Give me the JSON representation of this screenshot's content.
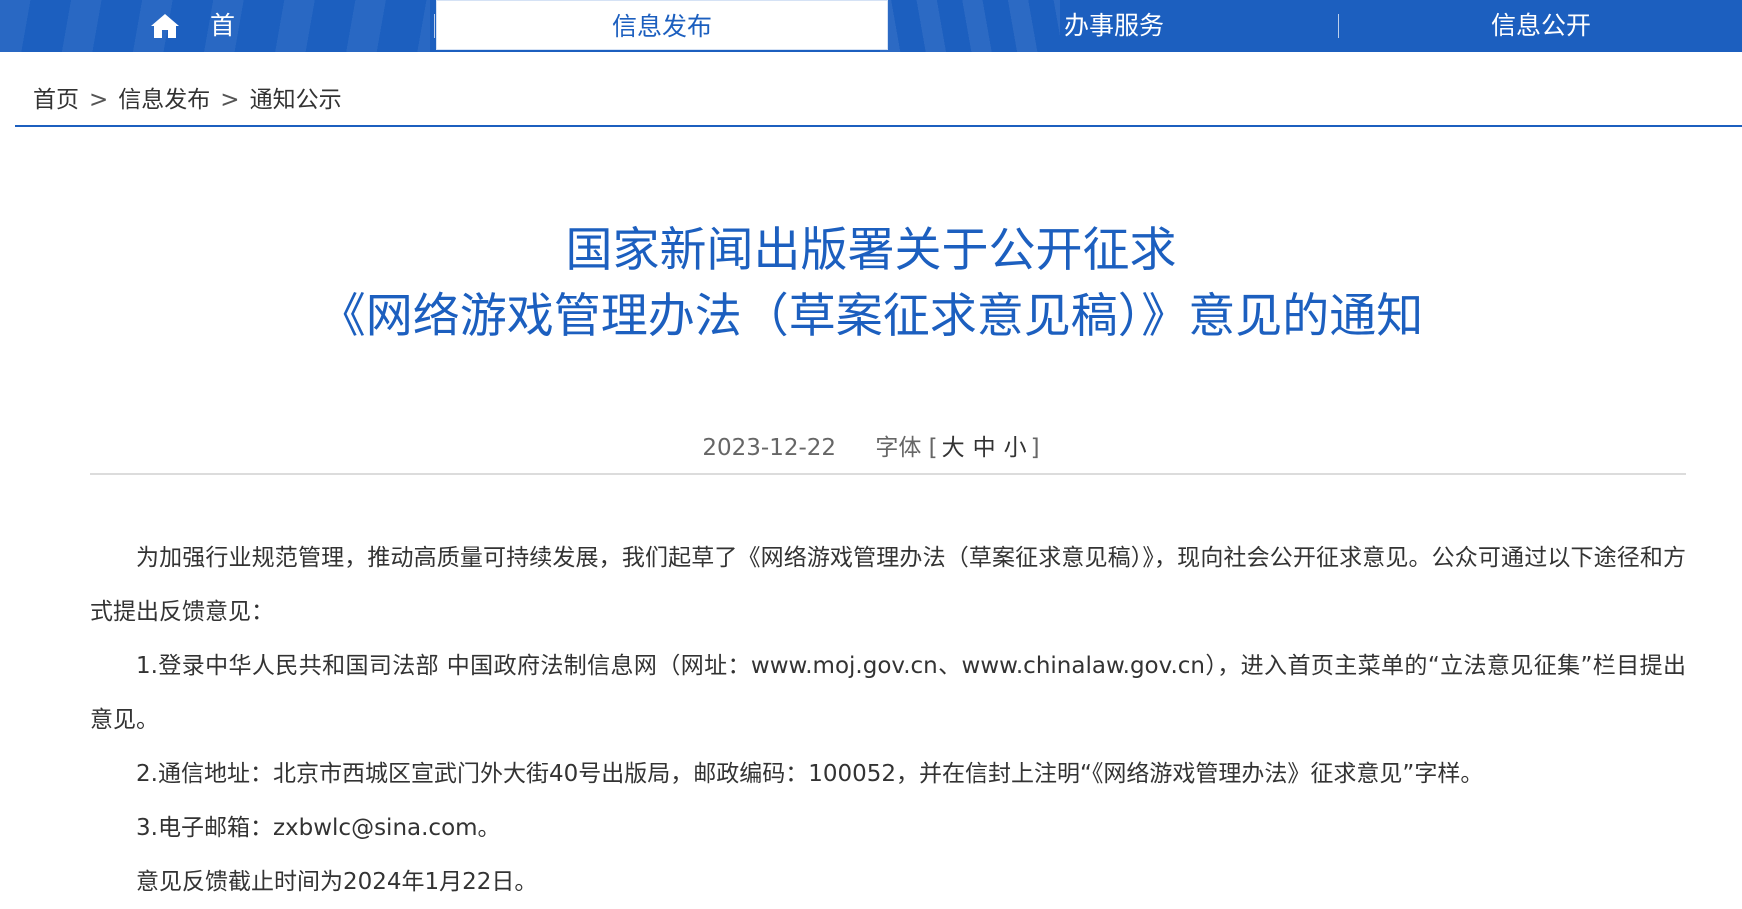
{
  "nav": {
    "home_label": "首 页",
    "info_publish": "信息发布",
    "services": "办事服务",
    "info_open": "信息公开"
  },
  "breadcrumb": {
    "home": "首页",
    "level1": "信息发布",
    "level2": "通知公示",
    "separator": ">"
  },
  "article": {
    "title_line1": "国家新闻出版署关于公开征求",
    "title_line2": "《网络游戏管理办法（草案征求意见稿）》意见的通知",
    "date": "2023-12-22",
    "font_size_label": "字体",
    "font_size_open": "[",
    "font_size_large": "大",
    "font_size_medium": "中",
    "font_size_small": "小",
    "font_size_close": "]",
    "paragraphs": [
      "为加强行业规范管理，推动高质量可持续发展，我们起草了《网络游戏管理办法（草案征求意见稿）》，现向社会公开征求意见。公众可通过以下途径和方式提出反馈意见：",
      "1.登录中华人民共和国司法部 中国政府法制信息网（网址：www.moj.gov.cn、www.chinalaw.gov.cn），进入首页主菜单的“立法意见征集”栏目提出意见。",
      "2.通信地址：北京市西城区宣武门外大街40号出版局，邮政编码：100052，并在信封上注明“《网络游戏管理办法》征求意见”字样。",
      "3.电子邮箱：zxbwlc@sina.com。",
      "意见反馈截止时间为2024年1月22日。"
    ]
  },
  "colors": {
    "brand_blue": "#1c5fbf",
    "text": "#333333",
    "meta": "#666666"
  },
  "icons": {
    "home": "home-icon"
  }
}
